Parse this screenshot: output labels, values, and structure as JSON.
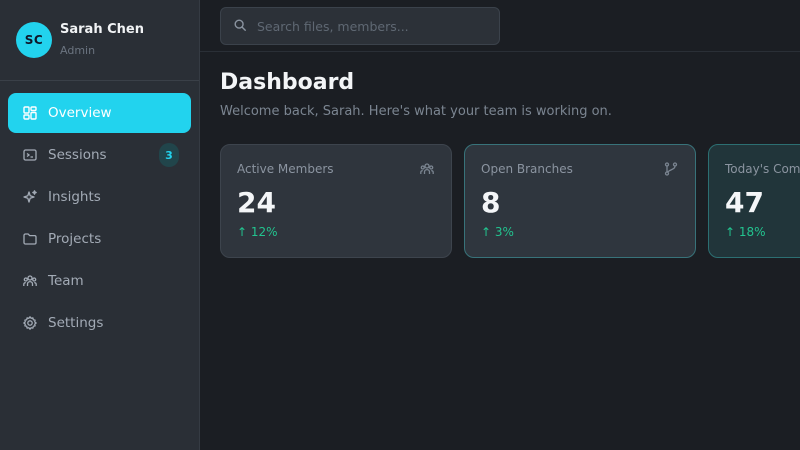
{
  "user": {
    "initials": "SC",
    "name": "Sarah Chen",
    "role": "Admin"
  },
  "nav": {
    "items": [
      {
        "label": "Overview",
        "icon": "grid-icon",
        "active": true
      },
      {
        "label": "Sessions",
        "icon": "terminal-icon",
        "badge": "3"
      },
      {
        "label": "Insights",
        "icon": "sparkles-icon"
      },
      {
        "label": "Projects",
        "icon": "folder-icon"
      },
      {
        "label": "Team",
        "icon": "users-icon"
      },
      {
        "label": "Settings",
        "icon": "gear-icon"
      }
    ]
  },
  "search": {
    "placeholder": "Search files, members...",
    "value": ""
  },
  "page": {
    "title": "Dashboard",
    "subtitle": "Welcome back, Sarah. Here's what your team is working on."
  },
  "stats": [
    {
      "label": "Active Members",
      "value": "24",
      "delta": "↑ 12%",
      "icon": "users-icon"
    },
    {
      "label": "Open Branches",
      "value": "8",
      "delta": "↑ 3%",
      "icon": "git-branch-icon"
    },
    {
      "label": "Today's Commits",
      "value": "47",
      "delta": "↑ 18%",
      "icon": "commit-icon"
    }
  ],
  "colors": {
    "accent": "#22d3ee",
    "positive": "#22c48f",
    "background": "#1b1e23",
    "sidebar": "#2a2f36"
  }
}
